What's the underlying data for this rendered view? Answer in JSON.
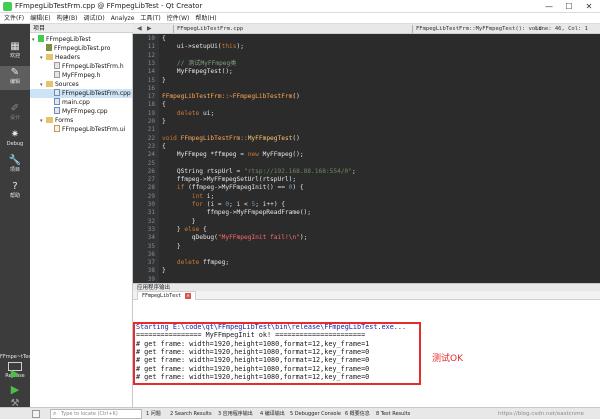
{
  "window": {
    "title": "FFmpegLibTestFrm.cpp @ FFmpegLibTest - Qt Creator",
    "controls": [
      "—",
      "☐",
      "✕"
    ]
  },
  "menu": [
    "文件(F)",
    "编辑(E)",
    "构建(B)",
    "调试(D)",
    "Analyze",
    "工具(T)",
    "控件(W)",
    "帮助(H)"
  ],
  "modes": [
    {
      "glyph": "▦",
      "label": "欢迎"
    },
    {
      "glyph": "✎",
      "label": "编辑"
    },
    {
      "glyph": "✐",
      "label": "设计"
    },
    {
      "glyph": "✷",
      "label": "Debug"
    },
    {
      "glyph": "🔧",
      "label": "项目"
    },
    {
      "glyph": "?",
      "label": "帮助"
    }
  ],
  "kit": {
    "name": "FFmpe~tTest",
    "config": "Release"
  },
  "project": {
    "header": "项目",
    "items": [
      {
        "label": "FFmpegLibTest",
        "kind": "proj",
        "indent": 0,
        "arrow": "▾"
      },
      {
        "label": "FFmpegLibTest.pro",
        "kind": "pro",
        "indent": 1,
        "arrow": ""
      },
      {
        "label": "Headers",
        "kind": "folder",
        "indent": 1,
        "arrow": "▾"
      },
      {
        "label": "FFmpegLibTestFrm.h",
        "kind": "h",
        "indent": 2,
        "arrow": ""
      },
      {
        "label": "MyFFmpeg.h",
        "kind": "h",
        "indent": 2,
        "arrow": ""
      },
      {
        "label": "Sources",
        "kind": "folder",
        "indent": 1,
        "arrow": "▾"
      },
      {
        "label": "FFmpegLibTestFrm.cpp",
        "kind": "cpp",
        "indent": 2,
        "arrow": "",
        "selected": true
      },
      {
        "label": "main.cpp",
        "kind": "cpp",
        "indent": 2,
        "arrow": ""
      },
      {
        "label": "MyFFmpeg.cpp",
        "kind": "cpp",
        "indent": 2,
        "arrow": ""
      },
      {
        "label": "Forms",
        "kind": "folder",
        "indent": 1,
        "arrow": "▾"
      },
      {
        "label": "FFmpegLibTestFrm.ui",
        "kind": "ui",
        "indent": 2,
        "arrow": ""
      }
    ]
  },
  "editor": {
    "file": "FFmpegLibTestFrm.cpp",
    "function": "FFmpegLibTestFrm::MyFFmpegTest(): void",
    "position": "Line: 46, Col: 1",
    "lines": [
      {
        "n": "10",
        "parts": [
          [
            "{",
            ""
          ]
        ]
      },
      {
        "n": "11",
        "parts": [
          [
            "    ui->setupUi(",
            ""
          ],
          [
            "this",
            "kw"
          ],
          [
            ");",
            ""
          ]
        ]
      },
      {
        "n": "12",
        "parts": [
          [
            "",
            ""
          ]
        ]
      },
      {
        "n": "13",
        "parts": [
          [
            "    // 测试MyFFmpeg类",
            "cmt"
          ]
        ]
      },
      {
        "n": "14",
        "parts": [
          [
            "    MyFFmpegTest();",
            ""
          ]
        ]
      },
      {
        "n": "15",
        "parts": [
          [
            "}",
            ""
          ]
        ]
      },
      {
        "n": "16",
        "parts": [
          [
            "",
            ""
          ]
        ]
      },
      {
        "n": "17",
        "parts": [
          [
            "FFmpegLibTestFrm::~FFmpegLibTestFrm",
            "fn"
          ],
          [
            "()",
            ""
          ]
        ]
      },
      {
        "n": "18",
        "parts": [
          [
            "{",
            ""
          ]
        ]
      },
      {
        "n": "19",
        "parts": [
          [
            "    ",
            ""
          ],
          [
            "delete",
            "kw"
          ],
          [
            " ui;",
            ""
          ]
        ]
      },
      {
        "n": "20",
        "parts": [
          [
            "}",
            ""
          ]
        ]
      },
      {
        "n": "21",
        "parts": [
          [
            "",
            ""
          ]
        ]
      },
      {
        "n": "22",
        "parts": [
          [
            "void",
            "kw"
          ],
          [
            " FFmpegLibTestFrm::",
            "fn"
          ],
          [
            "MyFFmpegTest",
            "type"
          ],
          [
            "()",
            ""
          ]
        ]
      },
      {
        "n": "23",
        "parts": [
          [
            "{",
            ""
          ]
        ]
      },
      {
        "n": "24",
        "parts": [
          [
            "    MyFFmpeg *ffmpeg = ",
            ""
          ],
          [
            "new",
            "kw"
          ],
          [
            " MyFFmpeg();",
            ""
          ]
        ]
      },
      {
        "n": "25",
        "parts": [
          [
            "",
            ""
          ]
        ]
      },
      {
        "n": "26",
        "parts": [
          [
            "    QString rtspUrl = ",
            ""
          ],
          [
            "\"rtsp://192.168.88.168:554/0\"",
            "str"
          ],
          [
            ";",
            ""
          ]
        ]
      },
      {
        "n": "27",
        "parts": [
          [
            "    ffmpeg->MyFFmpegSetUrl(rtspUrl);",
            ""
          ]
        ]
      },
      {
        "n": "28",
        "parts": [
          [
            "    ",
            ""
          ],
          [
            "if",
            "kw"
          ],
          [
            " (ffmpeg->MyFFmpegInit() == ",
            ""
          ],
          [
            "0",
            "num"
          ],
          [
            ") {",
            ""
          ]
        ]
      },
      {
        "n": "29",
        "parts": [
          [
            "        ",
            ""
          ],
          [
            "int",
            "kw"
          ],
          [
            " i;",
            ""
          ]
        ]
      },
      {
        "n": "30",
        "parts": [
          [
            "        ",
            ""
          ],
          [
            "for",
            "kw"
          ],
          [
            " (i = ",
            ""
          ],
          [
            "0",
            "num"
          ],
          [
            "; i < ",
            ""
          ],
          [
            "5",
            "num"
          ],
          [
            "; i++) {",
            ""
          ]
        ]
      },
      {
        "n": "31",
        "parts": [
          [
            "            ffmpeg->MyFFmpepReadFrame();",
            ""
          ]
        ]
      },
      {
        "n": "32",
        "parts": [
          [
            "        }",
            ""
          ]
        ]
      },
      {
        "n": "33",
        "parts": [
          [
            "    } ",
            ""
          ],
          [
            "else",
            "kw"
          ],
          [
            " {",
            ""
          ]
        ]
      },
      {
        "n": "34",
        "parts": [
          [
            "        qDebug(",
            ""
          ],
          [
            "\"MyFFmpegInit fail!\\n\"",
            "err"
          ],
          [
            ");",
            ""
          ]
        ]
      },
      {
        "n": "35",
        "parts": [
          [
            "    }",
            ""
          ]
        ]
      },
      {
        "n": "36",
        "parts": [
          [
            "",
            ""
          ]
        ]
      },
      {
        "n": "37",
        "parts": [
          [
            "    ",
            ""
          ],
          [
            "delete",
            "kw"
          ],
          [
            " ffmpeg;",
            ""
          ]
        ]
      },
      {
        "n": "38",
        "parts": [
          [
            "}",
            ""
          ]
        ]
      },
      {
        "n": "39",
        "parts": [
          [
            "",
            ""
          ]
        ]
      }
    ]
  },
  "output": {
    "header": "应用程序输出",
    "tab": "FFmpegLibTest",
    "lines": [
      "Starting E:\\code\\qt\\FFmpegLibTest\\bin\\release\\FFmpegLibTest.exe...",
      "================ MyFFmpegInit ok! ======================",
      "# get frame: width=1920,height=1080,format=12,key_frame=1",
      "# get frame: width=1920,height=1080,format=12,key_frame=0",
      "# get frame: width=1920,height=1080,format=12,key_frame=0",
      "# get frame: width=1920,height=1080,format=12,key_frame=0",
      "# get frame: width=1920,height=1080,format=12,key_frame=0"
    ],
    "annotation": "测试OK"
  },
  "statusbar": {
    "locate_placeholder": "Type to locate (Ctrl+K)",
    "items": [
      "1 问题",
      "2 Search Results",
      "3 应用程序输出",
      "4 编译输出",
      "5 Debugger Console",
      "6 概要信息",
      "8 Test Results"
    ],
    "watermark": "https://blog.csdn.net/eastcnme"
  },
  "colors": {
    "editor_bg": "#2b2b2b",
    "mode_bar": "#3c3c3c",
    "highlight": "#e52b2b"
  }
}
